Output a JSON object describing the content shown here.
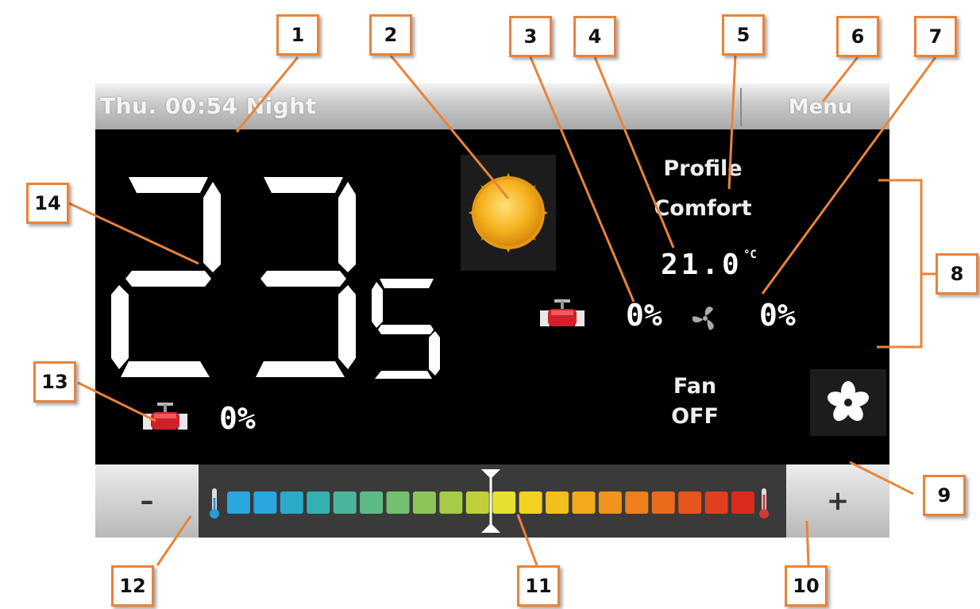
{
  "header": {
    "status_text": "Thu. 00:54 Night",
    "menu_label": "Menu"
  },
  "main": {
    "room_temperature_integer": "23",
    "room_temperature_decimal": "5",
    "profile_label": "Profile",
    "profile_value": "Comfort",
    "setpoint": "21.0",
    "setpoint_unit": "°C",
    "valve_percent": "0%",
    "fan_percent": "0%",
    "fan_label": "Fan",
    "fan_state": "OFF",
    "heating_valve_percent": "0%"
  },
  "controls": {
    "minus_label": "–",
    "plus_label": "+"
  },
  "scale": {
    "segment_colors": [
      "#2aa6e0",
      "#2aa6e0",
      "#2ca8c8",
      "#35b0b0",
      "#4ab59a",
      "#5dba86",
      "#73bf6f",
      "#8cc55a",
      "#a5cb47",
      "#bfd03a",
      "#e6e030",
      "#f2d120",
      "#f3bf1c",
      "#f3aa1a",
      "#f1941b",
      "#ee7f1c",
      "#ea6a1c",
      "#e5551c",
      "#e0401d",
      "#d92c1e"
    ],
    "indicator_position": 0.5,
    "cold_color": "#2a9ad8",
    "hot_color": "#d23a3a"
  },
  "callouts": [
    "1",
    "2",
    "3",
    "4",
    "5",
    "6",
    "7",
    "8",
    "9",
    "10",
    "11",
    "12",
    "13",
    "14"
  ],
  "colors": {
    "accent": "#e8833a",
    "sun": "#f2b51c",
    "valve": "#d0202a"
  }
}
